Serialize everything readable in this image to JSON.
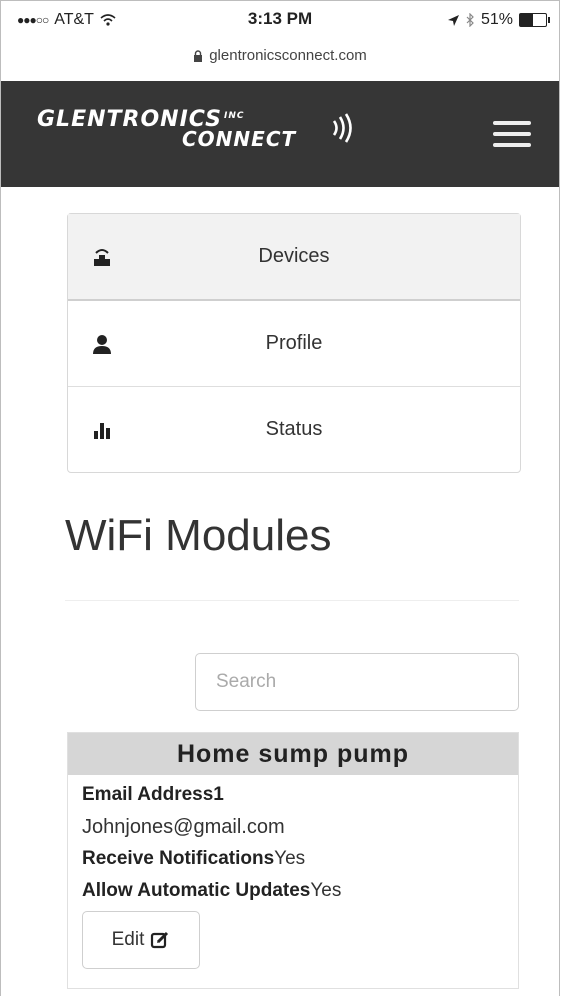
{
  "status_bar": {
    "carrier": "AT&T",
    "time": "3:13 PM",
    "battery": "51%",
    "battery_level": 0.51
  },
  "browser": {
    "url": "glentronicsconnect.com"
  },
  "header": {
    "logo_main": "GLENTRONICS",
    "logo_inc": "INC",
    "logo_sub": "CONNECT"
  },
  "nav": {
    "items": [
      {
        "label": "Devices",
        "icon": "router-icon",
        "active": true
      },
      {
        "label": "Profile",
        "icon": "user-icon",
        "active": false
      },
      {
        "label": "Status",
        "icon": "bar-chart-icon",
        "active": false
      }
    ]
  },
  "page": {
    "title": "WiFi Modules"
  },
  "search": {
    "placeholder": "Search"
  },
  "module": {
    "name": "Home sump pump",
    "email_label": "Email Address1",
    "email_value": "Johnjones@gmail.com",
    "notifications_label": "Receive Notifications",
    "notifications_value": "Yes",
    "updates_label": "Allow Automatic Updates",
    "updates_value": "Yes",
    "edit_label": "Edit"
  }
}
